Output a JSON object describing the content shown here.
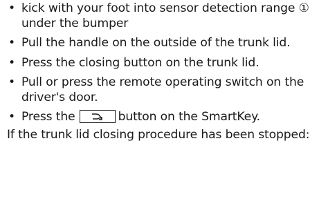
{
  "bullet_char": "•",
  "items": [
    {
      "text_a": "kick with your foot into sensor detection range ",
      "marker": "①",
      "text_b": " under the bumper"
    },
    {
      "text": "Pull the handle on the outside of the trunk lid."
    },
    {
      "text": "Press the closing button on the trunk lid."
    },
    {
      "text": "Pull or press the remote operating switch on the driver's door."
    },
    {
      "text_a": "Press the",
      "key_icon": "trunk-close-icon",
      "text_b": "button on the SmartKey."
    }
  ],
  "note": "If the trunk lid closing procedure has been stopped:"
}
